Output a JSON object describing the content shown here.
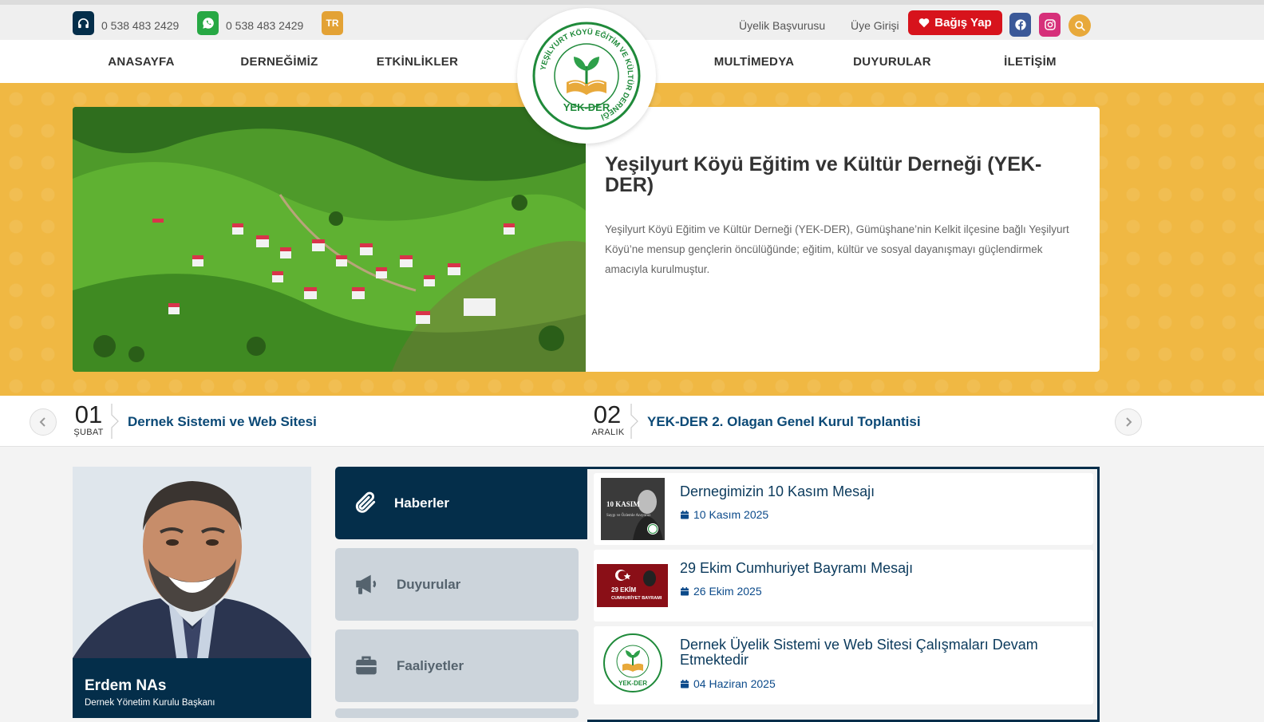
{
  "contact": {
    "phone1": "0 538 483 2429",
    "phone2": "0 538 483 2429",
    "lang": "TR"
  },
  "top_links": {
    "membership_apply": "Üyelik Başvurusu",
    "member_login": "Üye Girişi",
    "donate": "Bağış Yap"
  },
  "nav": {
    "items": [
      "ANASAYFA",
      "DERNEĞİMİZ",
      "ETKİNLİKLER",
      "MULTİMEDYA",
      "DUYURULAR",
      "İLETİŞİM"
    ]
  },
  "logo": {
    "ring_text": "YEŞİLYURT KÖYÜ EĞİTİM VE KÜLTÜR DERNEĞİ",
    "abbr": "YEK-DER"
  },
  "hero": {
    "title": "Yeşilyurt Köyü Eğitim ve Kültür Derneği (YEK-DER)",
    "text": "Yeşilyurt Köyü Eğitim ve Kültür Derneği (YEK-DER), Gümüşhane’nin Kelkit ilçesine bağlı Yeşilyurt Köyü’ne mensup gençlerin öncülüğünde; eğitim, kültür ve sosyal dayanışmayı güçlendirmek amacıyla kurulmuştur."
  },
  "ticker": [
    {
      "day": "01",
      "month": "ŞUBAT",
      "title": "Dernek Sistemi ve Web Sitesi"
    },
    {
      "day": "02",
      "month": "ARALIK",
      "title": "YEK-DER 2. Olagan Genel Kurul Toplantisi"
    }
  ],
  "person": {
    "name": "Erdem NAs",
    "role": "Dernek Yönetim Kurulu Başkanı"
  },
  "tabs": [
    {
      "label": "Haberler",
      "icon": "paperclip-icon",
      "active": true
    },
    {
      "label": "Duyurular",
      "icon": "megaphone-icon",
      "active": false
    },
    {
      "label": "Faaliyetler",
      "icon": "briefcase-icon",
      "active": false
    }
  ],
  "news": [
    {
      "title": "Dernegimizin 10 Kasım Mesajı",
      "date": "10 Kasım 2025",
      "thumb_text": "10 KASIM",
      "thumb_sub": "Saygı ve Özlemle Anıyoruz"
    },
    {
      "title": "29 Ekim Cumhuriyet Bayramı Mesajı",
      "date": "26 Ekim 2025",
      "thumb_text": "29 EKİM",
      "thumb_sub": "CUMHURİYET BAYRAMI"
    },
    {
      "title": "Dernek Üyelik Sistemi ve Web Sitesi Çalışmaları Devam Etmektedir",
      "date": "04 Haziran 2025",
      "thumb_text": "YEK-DER",
      "thumb_sub": ""
    }
  ],
  "colors": {
    "accent": "#f0b843",
    "navy": "#042e4a",
    "donate": "#d7131c"
  }
}
